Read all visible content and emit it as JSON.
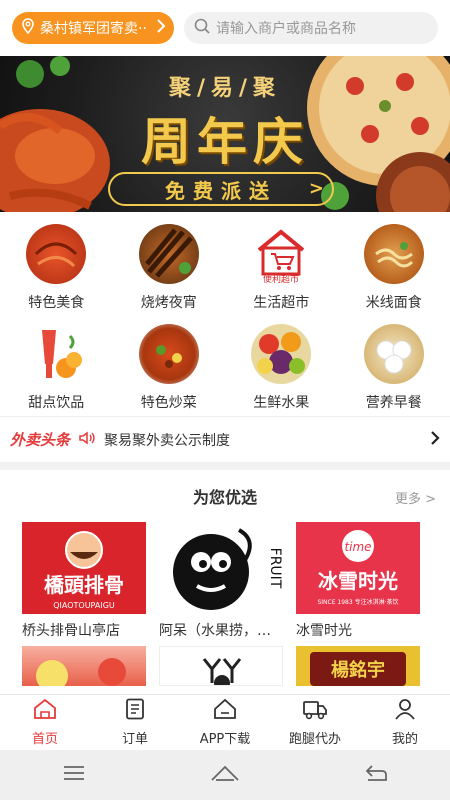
{
  "header": {
    "location": "桑村镇军团寄卖··",
    "search_placeholder": "请输入商户或商品名称"
  },
  "banner": {
    "subtitle": "聚/易/聚",
    "title": "周年庆",
    "cta": "免费派送"
  },
  "categories": [
    {
      "label": "特色美食",
      "icon": "crayfish-photo"
    },
    {
      "label": "烧烤夜宵",
      "icon": "skewers-photo"
    },
    {
      "label": "生活超市",
      "icon": "supermarket-icon",
      "icon_text": "便利超市"
    },
    {
      "label": "米线面食",
      "icon": "noodles-photo"
    },
    {
      "label": "甜点饮品",
      "icon": "drinks-photo"
    },
    {
      "label": "特色炒菜",
      "icon": "stirfry-photo"
    },
    {
      "label": "生鲜水果",
      "icon": "fruit-photo"
    },
    {
      "label": "营养早餐",
      "icon": "dumplings-photo"
    }
  ],
  "notice": {
    "brand": "外卖头条",
    "text": "聚易聚外卖公示制度"
  },
  "recommend": {
    "title": "为您优选",
    "more": "更多",
    "shops": [
      {
        "name": "桥头排骨山亭店",
        "logo_text": "橋頭排骨",
        "logo_sub": "QIAOTOUPAIGU"
      },
      {
        "name": "阿呆（水果捞，…",
        "logo_text": "FRUIT"
      },
      {
        "name": "冰雪时光",
        "logo_text": "冰雪时光",
        "logo_sub": "SINCE 1983 专注冰淇淋·茶饮",
        "badge": "time"
      }
    ],
    "shops_row2": [
      {
        "name": "",
        "logo_text": ""
      },
      {
        "name": "",
        "logo_text": ""
      },
      {
        "name": "",
        "logo_text": "楊銘宇"
      }
    ]
  },
  "tabbar": [
    {
      "label": "首页",
      "icon": "home-icon",
      "active": true
    },
    {
      "label": "订单",
      "icon": "order-icon",
      "active": false
    },
    {
      "label": "APP下载",
      "icon": "app-download-icon",
      "active": false
    },
    {
      "label": "跑腿代办",
      "icon": "delivery-truck-icon",
      "active": false
    },
    {
      "label": "我的",
      "icon": "user-icon",
      "active": false
    }
  ],
  "colors": {
    "accent_orange": "#f7931e",
    "accent_red": "#e53a3a",
    "banner_gold": "#f2c94c"
  }
}
